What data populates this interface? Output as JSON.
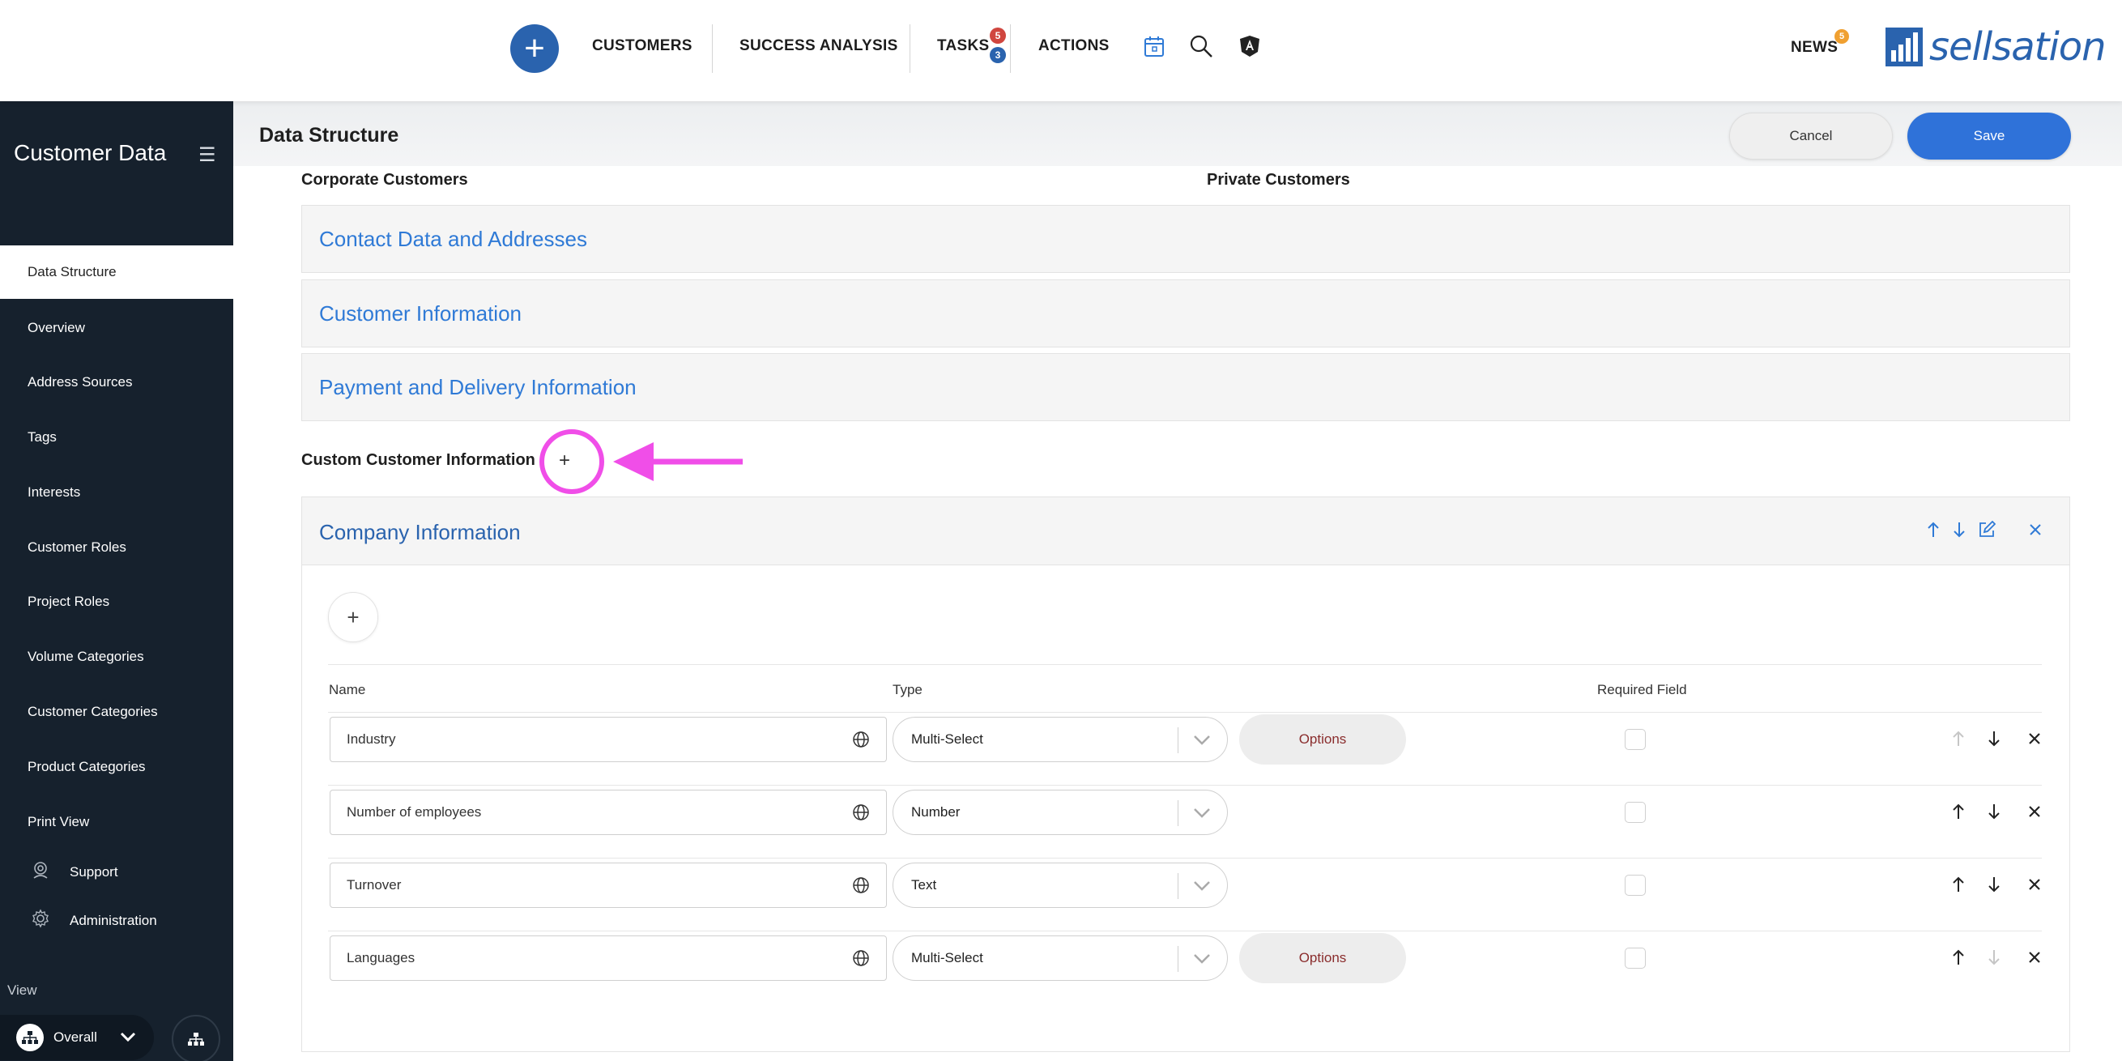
{
  "nav": {
    "items": [
      "CUSTOMERS",
      "SUCCESS ANALYSIS",
      "TASKS",
      "ACTIONS"
    ],
    "tasks_badge_red": "5",
    "tasks_badge_blue": "3",
    "news_label": "NEWS",
    "news_badge": "5",
    "logo_text": "sellsation",
    "icons": [
      "add-icon",
      "calendar-icon",
      "search-icon",
      "angular-shield-icon"
    ]
  },
  "sidebar": {
    "title": "Customer Data",
    "items": [
      {
        "label": "Data Structure",
        "active": true
      },
      {
        "label": "Overview"
      },
      {
        "label": "Address Sources"
      },
      {
        "label": "Tags"
      },
      {
        "label": "Interests"
      },
      {
        "label": "Customer Roles"
      },
      {
        "label": "Project Roles"
      },
      {
        "label": "Volume Categories"
      },
      {
        "label": "Customer Categories"
      },
      {
        "label": "Product Categories"
      },
      {
        "label": "Print View"
      }
    ],
    "support_label": "Support",
    "administration_label": "Administration",
    "view_label": "View",
    "view_value": "Overall"
  },
  "header": {
    "title": "Data Structure",
    "cancel_label": "Cancel",
    "save_label": "Save"
  },
  "main": {
    "corporate_label": "Corporate Customers",
    "private_label": "Private Customers",
    "sections": [
      "Contact Data and Addresses",
      "Customer Information",
      "Payment and Delivery Information"
    ],
    "custom_label": "Custom Customer Information",
    "custom_add": "+",
    "company": {
      "title": "Company Information",
      "add_label": "+",
      "columns": {
        "name": "Name",
        "type": "Type",
        "required": "Required Field"
      },
      "rows": [
        {
          "name": "Industry",
          "type": "Multi-Select",
          "options": "Options",
          "required": false
        },
        {
          "name": "Number of employees",
          "type": "Number",
          "required": false
        },
        {
          "name": "Turnover",
          "type": "Text",
          "required": false
        },
        {
          "name": "Languages",
          "type": "Multi-Select",
          "options": "Options",
          "required": false
        }
      ]
    }
  },
  "colors": {
    "accent": "#2a63ae",
    "link": "#2f7ad6",
    "sidebar_bg": "#16212d",
    "highlight": "#f04ee8",
    "badge_red": "#d0463f",
    "badge_orange": "#f0a030"
  }
}
